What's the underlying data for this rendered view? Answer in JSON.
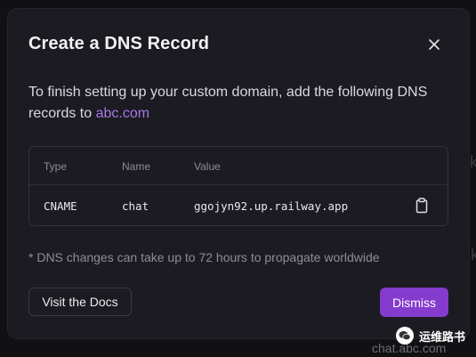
{
  "modal": {
    "title": "Create a DNS Record",
    "description_prefix": "To finish setting up your custom domain, add the following DNS records to",
    "domain_link": "abc.com",
    "close_icon": "close-icon",
    "table": {
      "headers": [
        "Type",
        "Name",
        "Value"
      ],
      "rows": [
        {
          "type": "CNAME",
          "name": "chat",
          "value": "ggojyn92.up.railway.app",
          "action_icon": "clipboard-icon"
        }
      ]
    },
    "note": "* DNS changes can take up to 72 hours to propagate worldwide",
    "docs_button": "Visit the Docs",
    "dismiss_button": "Dismiss"
  },
  "background": {
    "url_text": "chat.abc.com"
  },
  "watermark": {
    "text": "运维路书",
    "icon": "wechat-icon"
  },
  "colors": {
    "modal_bg": "#1c1b22",
    "accent": "#853bce",
    "link": "#a678e6"
  }
}
